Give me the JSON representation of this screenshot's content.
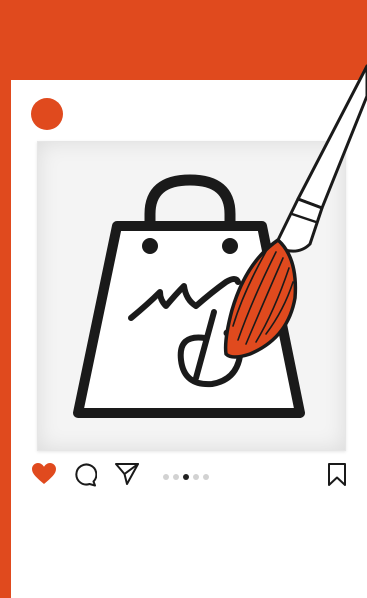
{
  "colors": {
    "accent": "#e04a1e",
    "ink": "#1a1a1a",
    "canvas": "#f4f4f4",
    "dot_inactive": "#d2d2d2",
    "dot_active": "#222222"
  },
  "post": {
    "avatar": "profile-avatar",
    "image": "shopping-bag-logo-with-paintbrush",
    "logo_lettering": "Mi"
  },
  "actions": {
    "like_icon": "heart-icon",
    "liked": true,
    "comment_icon": "comment-icon",
    "share_icon": "paper-plane-icon",
    "save_icon": "bookmark-icon"
  },
  "carousel": {
    "total": 5,
    "current": 3
  }
}
